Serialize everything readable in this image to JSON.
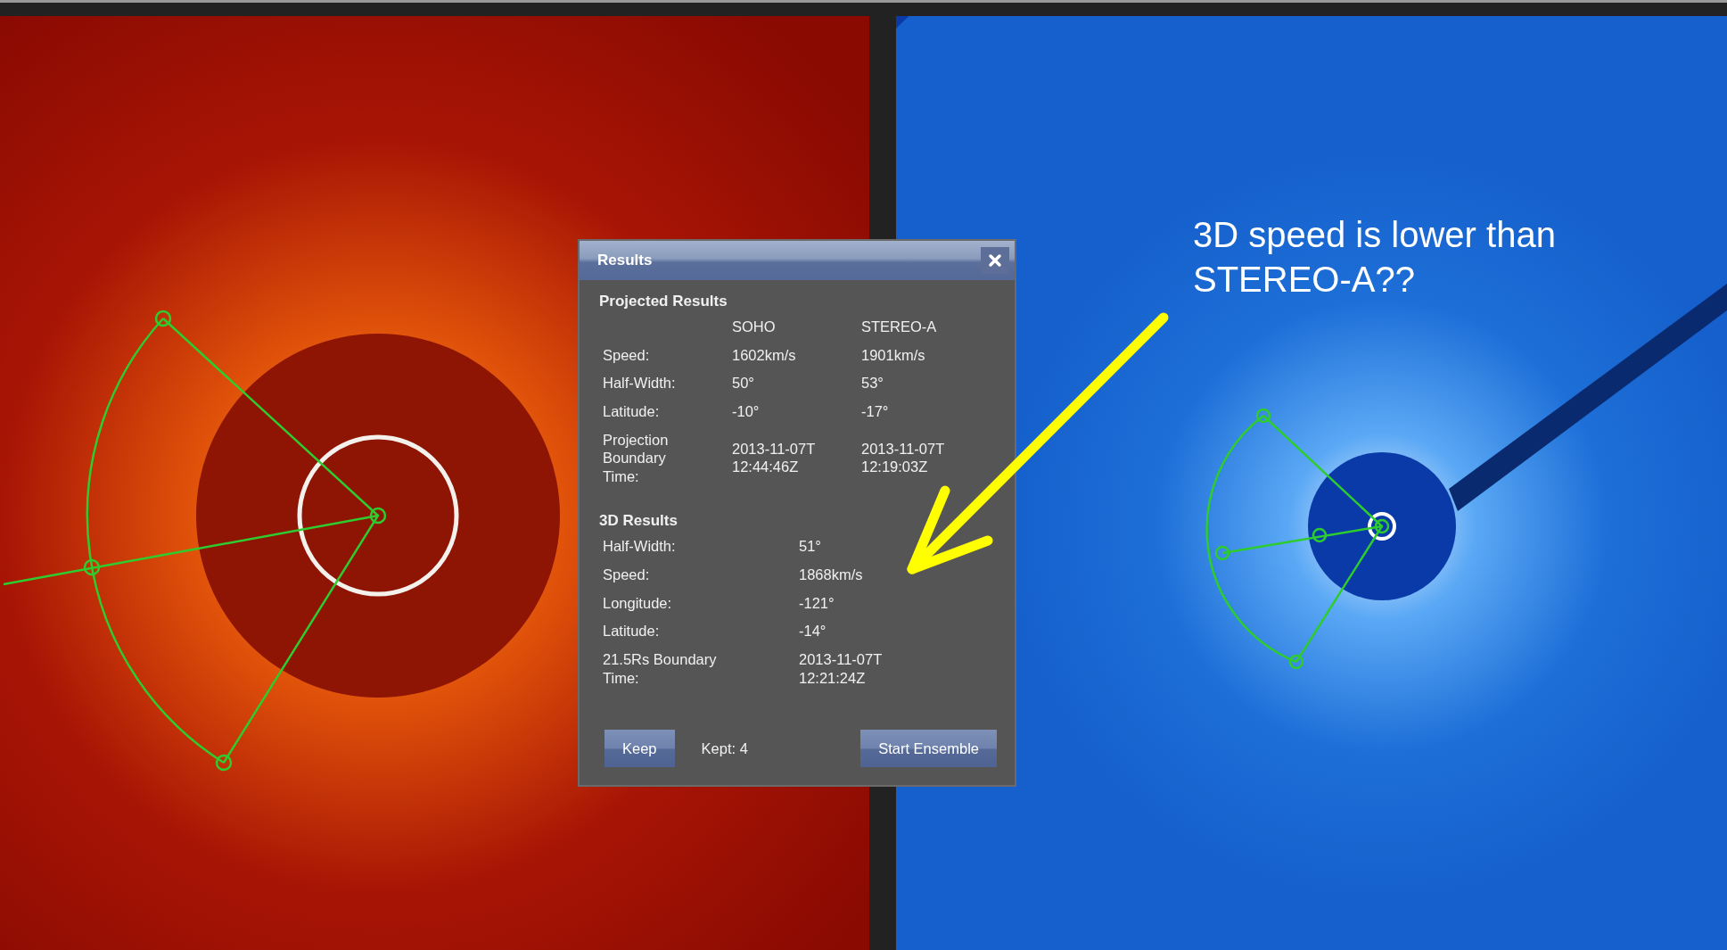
{
  "dialog": {
    "title": "Results",
    "projected": {
      "heading": "Projected Results",
      "columns": [
        "SOHO",
        "STEREO-A"
      ],
      "rows": [
        {
          "label": "Speed:",
          "values": [
            "1602km/s",
            "1901km/s"
          ]
        },
        {
          "label": "Half-Width:",
          "values": [
            "50°",
            "53°"
          ]
        },
        {
          "label": "Latitude:",
          "values": [
            "-10°",
            "-17°"
          ]
        },
        {
          "label": "Projection Boundary Time:",
          "values": [
            "2013-11-07T 12:44:46Z",
            "2013-11-07T 12:19:03Z"
          ]
        }
      ]
    },
    "three_d": {
      "heading": "3D Results",
      "rows": [
        {
          "label": "Half-Width:",
          "value": "51°"
        },
        {
          "label": "Speed:",
          "value": "1868km/s"
        },
        {
          "label": "Longitude:",
          "value": "-121°"
        },
        {
          "label": "Latitude:",
          "value": "-14°"
        },
        {
          "label": "21.5Rs Boundary Time:",
          "value": "2013-11-07T 12:21:24Z"
        }
      ]
    },
    "footer": {
      "keep_button": "Keep",
      "kept": "Kept: 4",
      "ensemble_button": "Start Ensemble"
    }
  },
  "annotation": {
    "text": "3D speed is lower than STEREO-A??"
  }
}
